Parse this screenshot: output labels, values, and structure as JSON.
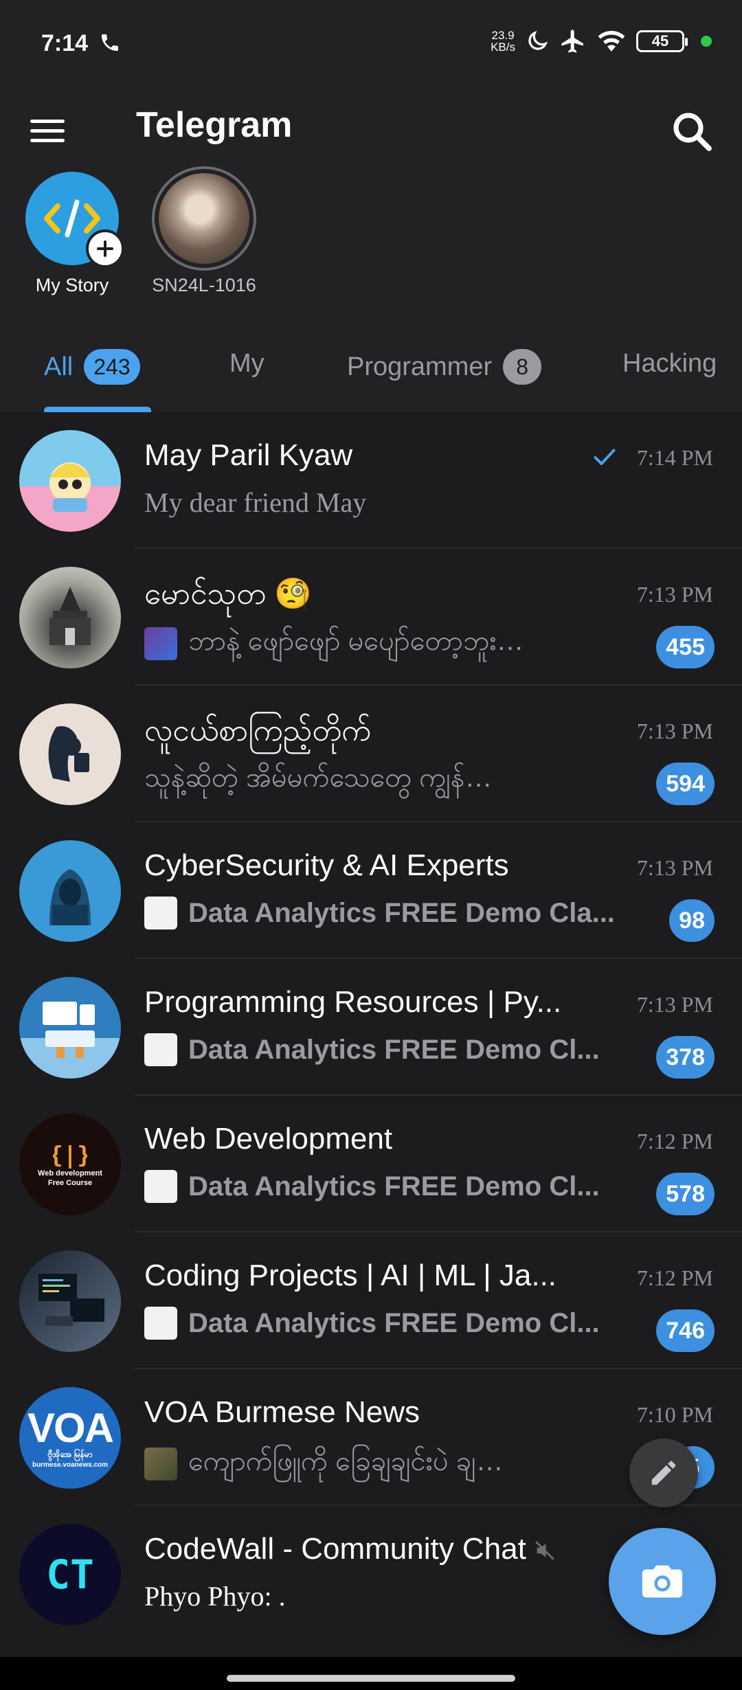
{
  "status_bar": {
    "time": "7:14",
    "net_speed_value": "23.9",
    "net_speed_unit": "KB/s",
    "battery": "45",
    "icons": [
      "phone-icon",
      "moon-icon",
      "airplane-icon",
      "wifi-icon",
      "battery-icon"
    ]
  },
  "header": {
    "title": "Telegram",
    "menu_icon": "hamburger-menu-icon",
    "search_icon": "search-icon"
  },
  "stories": [
    {
      "label": "My Story",
      "icon": "code-icon",
      "badge_icon": "plus-icon"
    },
    {
      "label": "SN24L-1016"
    }
  ],
  "tabs": [
    {
      "label": "All",
      "badge": "243",
      "active": true
    },
    {
      "label": "My",
      "badge": ""
    },
    {
      "label": "Programmer",
      "badge": "8"
    },
    {
      "label": "Hacking",
      "badge": ""
    }
  ],
  "chats": [
    {
      "title": "May Paril Kyaw",
      "time": "7:14 PM",
      "preview": "My dear friend May",
      "unread": "",
      "read_check": true,
      "avatar_color": "#9fd6f0"
    },
    {
      "title": "မောင်သုတ 🧐",
      "time": "7:13 PM",
      "preview": "ဘာနဲ့ ဖျော်ဖျော် မပျော်တော့ဘူး…",
      "unread": "455",
      "avatar_color": "#bdbdb5"
    },
    {
      "title": "လူငယ်စာကြည့်တိုက်",
      "time": "7:13 PM",
      "preview": "သူနဲ့ဆိုတဲ့  အိမ်မက်သေတွေ ကျွန်…",
      "unread": "594",
      "avatar_color": "#eadfd6"
    },
    {
      "title": "CyberSecurity & AI Experts",
      "time": "7:13 PM",
      "preview": "Data Analytics FREE Demo Cla...",
      "unread": "98",
      "avatar_color": "#3a9ad8"
    },
    {
      "title": "Programming Resources | Py...",
      "time": "7:13 PM",
      "preview": "Data Analytics FREE Demo Cl...",
      "unread": "378",
      "avatar_color": "#3d8ec9"
    },
    {
      "title": "Web Development",
      "time": "7:12 PM",
      "preview": "Data Analytics FREE Demo Cl...",
      "unread": "578",
      "avatar_color": "#1a0c0a",
      "avatar_text": "Web development Free Course"
    },
    {
      "title": "Coding Projects | AI | ML | Ja...",
      "time": "7:12 PM",
      "preview": "Data Analytics FREE Demo Cl...",
      "unread": "746",
      "avatar_color": "#3a4a5a"
    },
    {
      "title": "VOA Burmese News",
      "time": "7:10 PM",
      "preview": "ကျောက်ဖြူကို ခြေချချင်းပဲ ချ…",
      "unread": "5",
      "avatar_color": "#1f6bc2",
      "avatar_text": "VOA",
      "avatar_subtext": "ဗွီအိုအေ မြန်မာ",
      "avatar_caption": "burmese.voanews.com"
    },
    {
      "title": "CodeWall - Community Chat",
      "time": "",
      "preview": "Phyo Phyo: .",
      "unread": "",
      "muted": true,
      "avatar_color": "#0c0c2a",
      "avatar_text": "CT"
    }
  ],
  "fab": {
    "pencil_icon": "pencil-icon",
    "camera_icon": "camera-icon"
  },
  "colors": {
    "accent": "#4ba3f0",
    "background": "#1c1c1e",
    "header": "#222224",
    "badge": "#3d8fe0"
  }
}
